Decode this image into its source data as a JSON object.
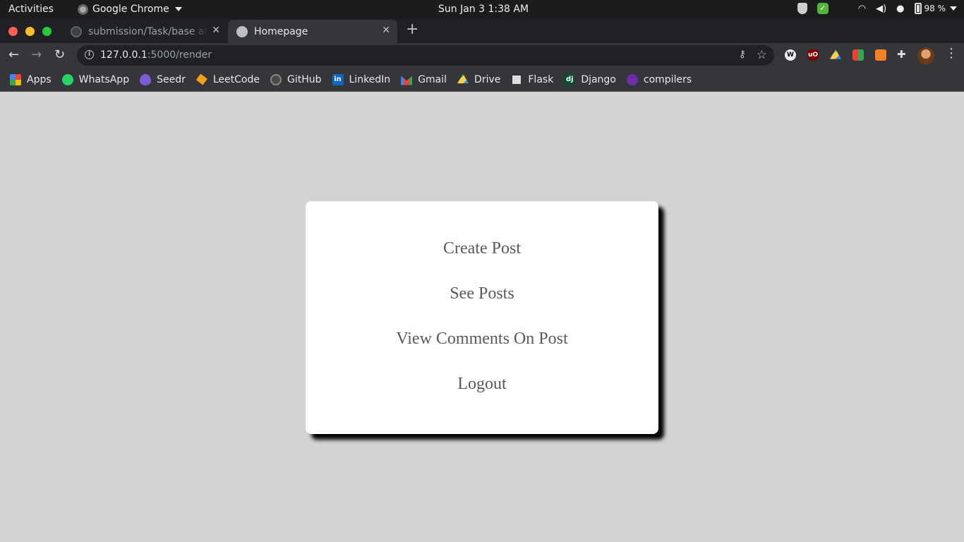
{
  "os_topbar": {
    "activities": "Activities",
    "app_name": "Google Chrome",
    "clock": "Sun Jan 3   1:38 AM",
    "battery": "98 %"
  },
  "browser": {
    "tabs": [
      {
        "title": "submission/Task/base at",
        "active": false
      },
      {
        "title": "Homepage",
        "active": true
      }
    ],
    "url_host": "127.0.0.1",
    "url_path": ":5000/render",
    "bookmarks": [
      {
        "label": "Apps",
        "icon": "apps-icon"
      },
      {
        "label": "WhatsApp",
        "icon": "whatsapp-icon"
      },
      {
        "label": "Seedr",
        "icon": "seedr-icon"
      },
      {
        "label": "LeetCode",
        "icon": "leetcode-icon"
      },
      {
        "label": "GitHub",
        "icon": "github-icon"
      },
      {
        "label": "LinkedIn",
        "icon": "linkedin-icon"
      },
      {
        "label": "Gmail",
        "icon": "gmail-icon"
      },
      {
        "label": "Drive",
        "icon": "drive-icon"
      },
      {
        "label": "Flask",
        "icon": "flask-icon"
      },
      {
        "label": "Django",
        "icon": "django-icon"
      },
      {
        "label": "compilers",
        "icon": "compilers-icon"
      }
    ]
  },
  "page": {
    "menu": [
      "Create Post",
      "See Posts",
      "View Comments On Post",
      "Logout"
    ]
  },
  "colors": {
    "page_background": "#d3d3d3",
    "card_background": "#ffffff",
    "link_text": "#5a5a5a"
  }
}
